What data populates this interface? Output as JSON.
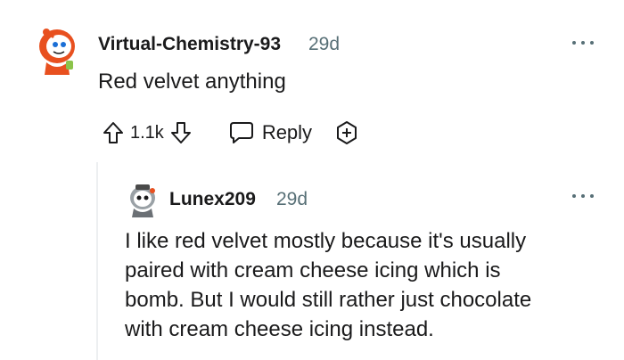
{
  "comment": {
    "avatar_icon": "snoo-avatar-icon",
    "username": "Virtual-Chemistry-93",
    "timestamp": "29d",
    "body": "Red velvet anything",
    "score": "1.1k",
    "reply_label": "Reply",
    "more_icon": "more-options-icon",
    "upvote_icon": "upvote-arrow-icon",
    "downvote_icon": "downvote-arrow-icon",
    "reply_icon": "speech-bubble-icon",
    "award_icon": "award-plus-icon"
  },
  "reply": {
    "avatar_icon": "snoo-avatar-icon",
    "username": "Lunex209",
    "timestamp": "29d",
    "body_lines": [
      "I like red velvet mostly because it's usually",
      "paired with cream cheese icing which is",
      "bomb. But I would still rather just chocolate",
      "with cream cheese icing instead."
    ],
    "more_icon": "more-options-icon"
  },
  "colors": {
    "text": "#1a1a1b",
    "meta": "#576f76",
    "thread_line": "#edeff1",
    "avatar_red": "#e8501f"
  }
}
